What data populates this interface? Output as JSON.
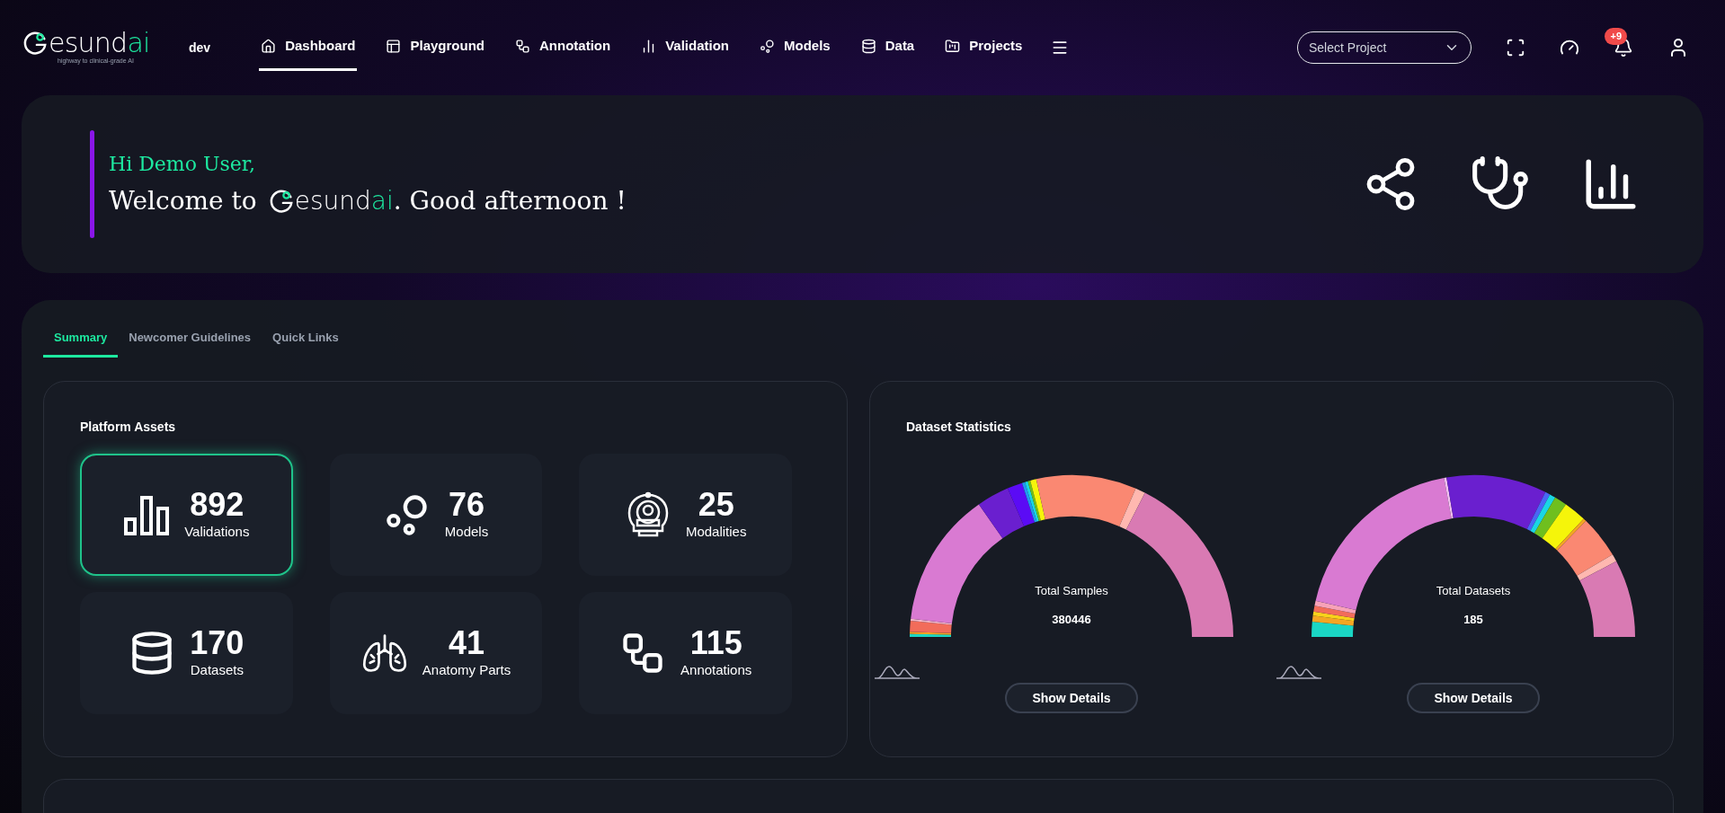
{
  "header": {
    "logo": {
      "text": "esund",
      "accent": "ai",
      "tagline": "highway to clinical-grade AI"
    },
    "environment": "dev",
    "nav": [
      {
        "label": "Dashboard",
        "kind": "home",
        "selected": true
      },
      {
        "label": "Playground",
        "kind": "panels",
        "selected": false
      },
      {
        "label": "Annotation",
        "kind": "workflow",
        "selected": false
      },
      {
        "label": "Validation",
        "kind": "bars",
        "selected": false
      },
      {
        "label": "Models",
        "kind": "circles",
        "selected": false
      },
      {
        "label": "Data",
        "kind": "database",
        "selected": false
      },
      {
        "label": "Projects",
        "kind": "folder",
        "selected": false
      }
    ],
    "project_select": {
      "placeholder": "Select Project"
    },
    "notifications": {
      "badge": "+9"
    }
  },
  "banner": {
    "greeting": "Hi Demo User,",
    "welcome_prefix": "Welcome to",
    "logo": {
      "text": "esund",
      "accent": "ai"
    },
    "welcome_suffix": ". Good afternoon !"
  },
  "tabs": [
    {
      "label": "Summary",
      "selected": true
    },
    {
      "label": "Newcomer Guidelines",
      "selected": false
    },
    {
      "label": "Quick Links",
      "selected": false
    }
  ],
  "platform_assets": {
    "title": "Platform Assets",
    "items": [
      {
        "value": "892",
        "label": "Validations",
        "kind": "bars",
        "selected": true
      },
      {
        "value": "76",
        "label": "Models",
        "kind": "circles",
        "selected": false
      },
      {
        "value": "25",
        "label": "Modalities",
        "kind": "scanner",
        "selected": false
      },
      {
        "value": "170",
        "label": "Datasets",
        "kind": "database",
        "selected": false
      },
      {
        "value": "41",
        "label": "Anatomy Parts",
        "kind": "lungs",
        "selected": false
      },
      {
        "value": "115",
        "label": "Annotations",
        "kind": "workflow",
        "selected": false
      }
    ]
  },
  "dataset_statistics": {
    "title": "Dataset Statistics",
    "charts": [
      {
        "label": "Total Samples",
        "value": "380446",
        "button": "Show Details"
      },
      {
        "label": "Total Datasets",
        "value": "185",
        "button": "Show Details"
      }
    ]
  }
}
